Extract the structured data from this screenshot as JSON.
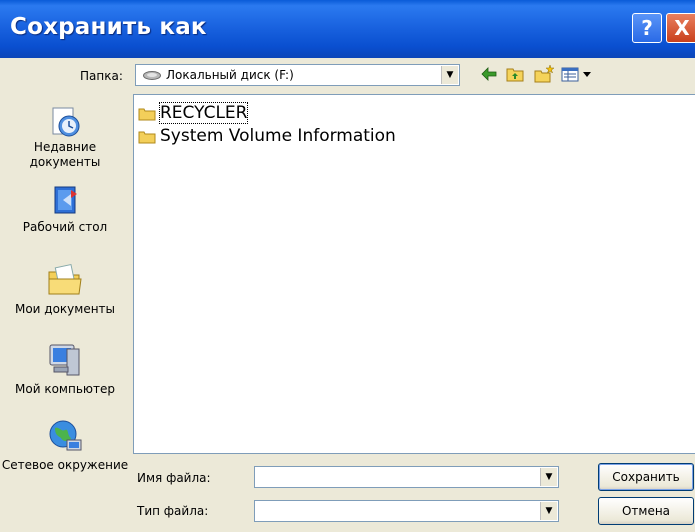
{
  "dialog": {
    "title": "Сохранить как",
    "help_label": "?",
    "close_label": "X"
  },
  "folder": {
    "label": "Папка:",
    "value": "Локальный диск (F:)"
  },
  "places": [
    {
      "label": "Недавние документы",
      "icon": "recent-documents-icon"
    },
    {
      "label": "Рабочий стол",
      "icon": "desktop-icon"
    },
    {
      "label": "Мои документы",
      "icon": "my-documents-icon"
    },
    {
      "label": "Мой компьютер",
      "icon": "my-computer-icon"
    },
    {
      "label": "Сетевое окружение",
      "icon": "network-places-icon"
    }
  ],
  "files": [
    {
      "name": "RECYCLER",
      "type": "folder"
    },
    {
      "name": "System Volume Information",
      "type": "folder"
    }
  ],
  "filename": {
    "label": "Имя файла:",
    "value": ""
  },
  "filetype": {
    "label": "Тип файла:",
    "value": ""
  },
  "buttons": {
    "save": "Сохранить",
    "cancel": "Отмена"
  }
}
